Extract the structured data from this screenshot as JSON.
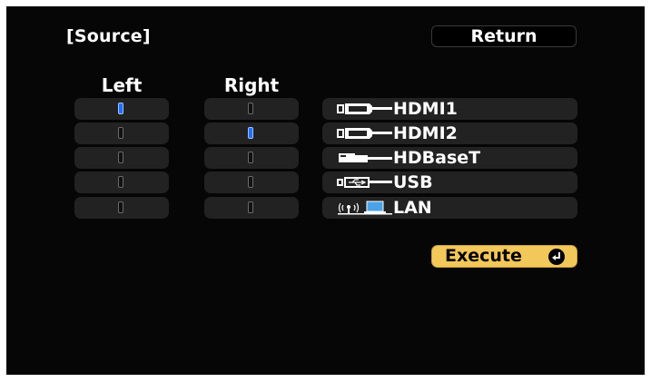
{
  "title": "[Source]",
  "return_label": "Return",
  "columns": {
    "left": "Left",
    "right": "Right"
  },
  "left_selected_index": 0,
  "right_selected_index": 1,
  "sources": [
    {
      "label": "HDMI1",
      "icon": "hdmi-icon"
    },
    {
      "label": "HDMI2",
      "icon": "hdmi-icon"
    },
    {
      "label": "HDBaseT",
      "icon": "lan-cable-icon"
    },
    {
      "label": "USB",
      "icon": "usb-icon"
    },
    {
      "label": "LAN",
      "icon": "network-pc-icon"
    }
  ],
  "execute_label": "Execute",
  "colors": {
    "background": "#060606",
    "selected_marker": "#1f6fff",
    "execute_button": "#f3c85a"
  }
}
